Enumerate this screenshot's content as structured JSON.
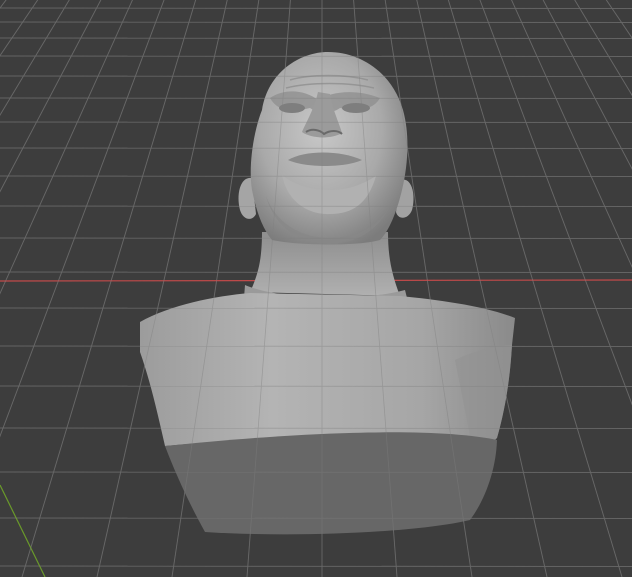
{
  "viewport": {
    "background": "#3d3d3d",
    "grid_color": "#555555",
    "x_axis_color": "#c24a4a",
    "y_axis_color": "#6a9a2a"
  },
  "model": {
    "type": "sculpted-bust",
    "material": "clay-gray",
    "surface_color": "#a7a7a7",
    "cut_face_color": "#686868"
  }
}
